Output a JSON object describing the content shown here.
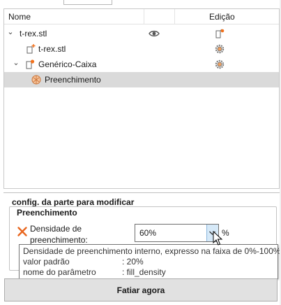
{
  "tree": {
    "columns": {
      "name": "Nome",
      "edit": "Edição"
    },
    "rows": [
      {
        "label": "t-rex.stl",
        "icon": "object-icon",
        "extra_icon": "eye-icon",
        "edit_icon": "add-part-icon"
      },
      {
        "label": "t-rex.stl",
        "icon": "part-add-icon",
        "edit_icon": "gear-icon"
      },
      {
        "label": "Genérico-Caixa",
        "icon": "modifier-box-icon",
        "edit_icon": "gear-icon"
      },
      {
        "label": "Preenchimento",
        "icon": "infill-settings-icon",
        "selected": true
      }
    ]
  },
  "settings": {
    "section_title": "config. da parte para modificar",
    "group_title": "Preenchimento",
    "param": {
      "label_line1": "Densidade de",
      "label_line2": "preenchimento:",
      "value": "60%",
      "unit": "%"
    },
    "tooltip": {
      "description": "Densidade de preenchimento interno, expresso na faixa de 0%-100%.",
      "default_label": "valor padrão",
      "default_value": ": 20%",
      "param_name_label": "nome do parâmetro",
      "param_name_value": ": fill_density"
    }
  },
  "actions": {
    "slice_label": "Fatiar agora"
  },
  "colors": {
    "accent_orange": "#f2711c",
    "selection_gray": "#dadada",
    "combo_button": "#d6e9f8",
    "remove_x": "#e8661e"
  }
}
